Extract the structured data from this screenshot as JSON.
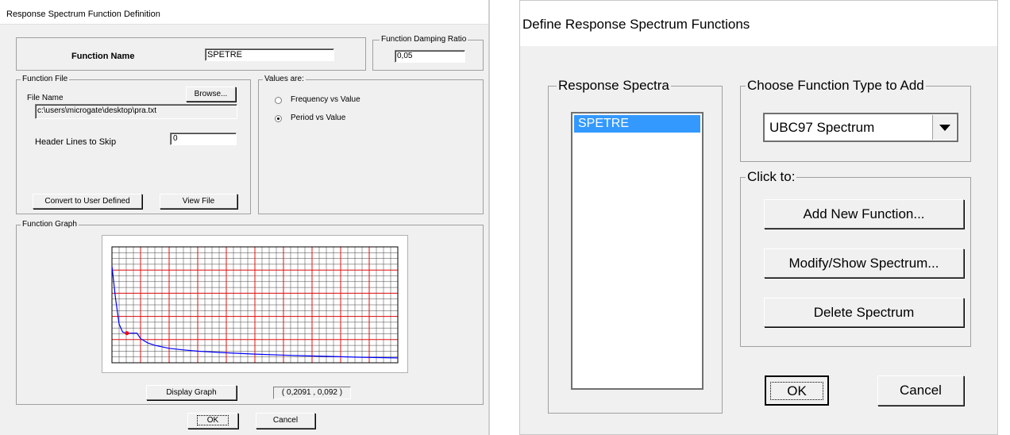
{
  "left_dialog": {
    "title": "Response Spectrum  Function Definition",
    "function_name_label": "Function Name",
    "function_name_value": "SPETRE",
    "damping_group": "Function Damping Ratio",
    "damping_value": "0,05",
    "function_file_group": "Function File",
    "file_name_label": "File Name",
    "browse_button": "Browse...",
    "file_path": "c:\\users\\microgate\\desktop\\pra.txt",
    "header_lines_label": "Header Lines to Skip",
    "header_lines_value": "0",
    "convert_button": "Convert to User Defined",
    "view_file_button": "View File",
    "values_group": "Values are:",
    "radio_frequency": "Frequency vs Value",
    "radio_period": "Period vs Value",
    "selected_radio": "period",
    "graph_group": "Function Graph",
    "display_graph_button": "Display Graph",
    "coordinate_readout": "( 0,2091  ,  0,092 )",
    "ok_button": "OK",
    "cancel_button": "Cancel"
  },
  "right_dialog": {
    "title": "Define Response Spectrum Functions",
    "spectra_group": "Response Spectra",
    "spectra_items": [
      "SPETRE"
    ],
    "selected_item": "SPETRE",
    "type_group": "Choose  Function Type to Add",
    "type_selected": "UBC97 Spectrum",
    "click_group": "Click to:",
    "add_button": "Add New Function...",
    "modify_button": "Modify/Show Spectrum...",
    "delete_button": "Delete Spectrum",
    "ok_button": "OK",
    "cancel_button": "Cancel"
  },
  "chart_data": {
    "type": "line",
    "xlim": [
      0,
      4
    ],
    "ylim": [
      0,
      0.36
    ],
    "grid": true,
    "series": [
      {
        "x": [
          0,
          0.05,
          0.1,
          0.15,
          0.2091,
          0.35,
          0.4,
          0.5,
          0.6,
          0.8,
          1.0,
          1.2,
          1.5,
          2.0,
          2.5,
          3.0,
          3.5,
          4.0
        ],
        "values": [
          0.3,
          0.2,
          0.12,
          0.095,
          0.092,
          0.092,
          0.075,
          0.062,
          0.054,
          0.045,
          0.04,
          0.036,
          0.032,
          0.027,
          0.023,
          0.02,
          0.017,
          0.015
        ]
      }
    ],
    "marker": {
      "x": 0.2091,
      "y": 0.092
    },
    "colors": {
      "line": "#0000ff",
      "major_grid": "#e01010",
      "minor_grid": "#404040",
      "marker": "#ff0000"
    }
  }
}
